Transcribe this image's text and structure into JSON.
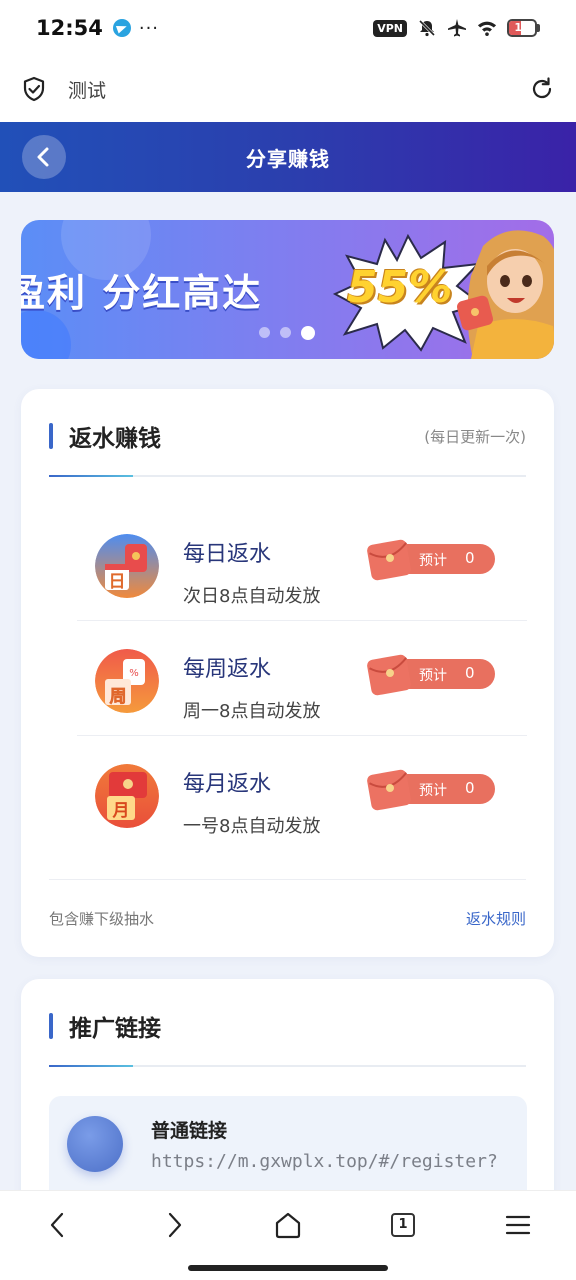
{
  "status_bar": {
    "time": "12:54",
    "more": "···",
    "vpn": "VPN",
    "battery": "14",
    "battery_level": 0.14,
    "battery_color": "#e05a5a"
  },
  "browser": {
    "title": "测试",
    "icons": [
      "shield-check-icon",
      "reload-icon"
    ]
  },
  "header": {
    "title": "分享赚钱",
    "gradient": [
      "#2150b8",
      "#3a22a8"
    ]
  },
  "banner": {
    "text": "盈利 分红高达",
    "highlight": "55%",
    "dots": 3,
    "active_dot": 2
  },
  "rebate_card": {
    "title": "返水赚钱",
    "note": "(每日更新一次)",
    "rows": [
      {
        "title": "每日返水",
        "subtitle": "次日8点自动发放",
        "badge": "日",
        "estimate_label": "预计",
        "estimate_value": "0"
      },
      {
        "title": "每周返水",
        "subtitle": "周一8点自动发放",
        "badge": "周",
        "estimate_label": "预计",
        "estimate_value": "0"
      },
      {
        "title": "每月返水",
        "subtitle": "一号8点自动发放",
        "badge": "月",
        "estimate_label": "预计",
        "estimate_value": "0"
      }
    ],
    "footer_left": "包含赚下级抽水",
    "footer_right": "返水规则"
  },
  "promo_card": {
    "title": "推广链接",
    "link_title": "普通链接",
    "link_url": "https://m.gxwplx.top/#/register?"
  },
  "bottom_nav": {
    "tab_count": "1",
    "icons": [
      "back-icon",
      "forward-icon",
      "home-icon",
      "tabs-icon",
      "menu-icon"
    ]
  },
  "colors": {
    "accent": "#3a67c9",
    "estimate_pill": "#e8705f",
    "rebate_title": "#28367a"
  }
}
